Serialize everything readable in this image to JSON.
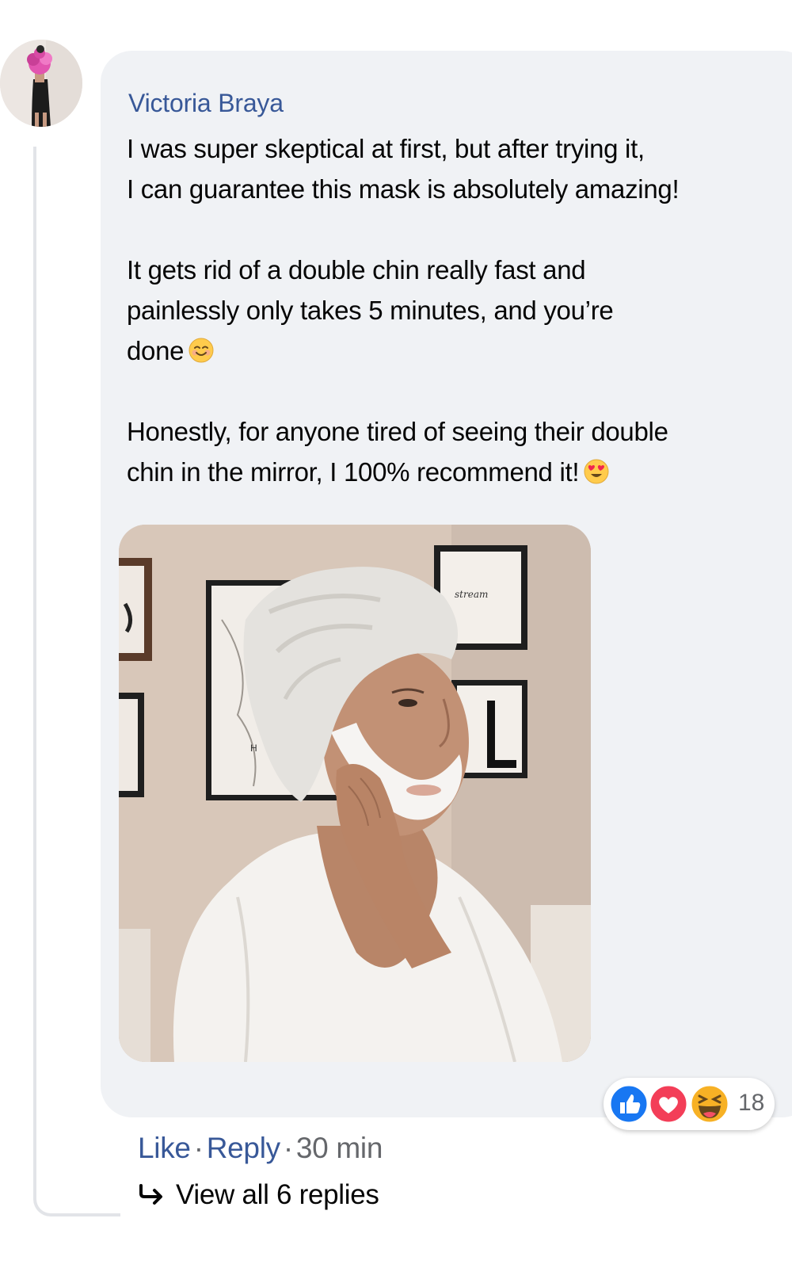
{
  "comment": {
    "author": "Victoria Braya",
    "paragraph_1_line_1": "I was super skeptical at first, but after trying it,",
    "paragraph_1_line_2": "I can guarantee this mask is absolutely amazing!",
    "paragraph_2_line_1": "It gets rid of a double chin really fast and",
    "paragraph_2_line_2": "painlessly only takes 5 minutes, and you’re",
    "paragraph_2_line_3": "done",
    "paragraph_3_line_1": "Honestly, for anyone tired of seeing their double",
    "paragraph_3_line_2": "chin in the mirror, I 100% recommend it!",
    "photo_frame_text": "stream",
    "photo_poster_letter": "H"
  },
  "reactions": {
    "count": "18",
    "types": [
      "like-icon",
      "love-icon",
      "haha-icon"
    ],
    "colors": {
      "like": "#1877f2",
      "love": "#f33e58",
      "haha": "#f7b125"
    }
  },
  "actions": {
    "like_label": "Like",
    "separator": "·",
    "reply_label": "Reply",
    "time": "30 min"
  },
  "replies": {
    "label": "View all 6 replies"
  },
  "colors": {
    "link": "#385898",
    "bubble": "#f0f2f5",
    "muted": "#65676b"
  }
}
